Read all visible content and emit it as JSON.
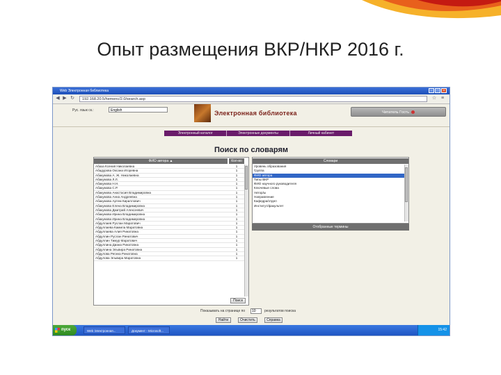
{
  "slide": {
    "title": "Опыт размещения ВКР/НКР 2016 г."
  },
  "browser": {
    "window_title": "Web Электронная библиотека",
    "url": "192.168.20.5/hemenc/2.0/search.asp"
  },
  "site": {
    "lang_label": "Рус.  язык  ск.:",
    "lang_value": "English",
    "library_title": "Электронная библиотека",
    "reader_label": "Читатель Гость",
    "menu": [
      "Электронный каталог",
      "Электронные документы",
      "Личный кабинет"
    ],
    "search_title": "Поиск по словарям"
  },
  "authors": {
    "header_name": "ФИО автора  ▲",
    "header_count": "Кол-во",
    "rows": [
      {
        "name": "Абаза Ксения Николаевна",
        "count": "1"
      },
      {
        "name": "Абадурова Оксана Игоревна",
        "count": "1"
      },
      {
        "name": "Абакумова А. Ж. Николаевна",
        "count": "1"
      },
      {
        "name": "Абакумова Л.Л.",
        "count": "1"
      },
      {
        "name": "Абакумова Н.Н.",
        "count": "1"
      },
      {
        "name": "Абакумова С.Р.",
        "count": "1"
      },
      {
        "name": "Абакумова Анастасия Владимировна",
        "count": "1"
      },
      {
        "name": "Абакумова Анна Андреевна",
        "count": "1"
      },
      {
        "name": "Абакумова Артем Кириллович",
        "count": "1"
      },
      {
        "name": "Абакумова Елена Владимировна",
        "count": "1"
      },
      {
        "name": "Абакумова Дмитрий Алексеевич",
        "count": "1"
      },
      {
        "name": "Абакумова Ирина Владимировна",
        "count": "1"
      },
      {
        "name": "Абакумова Ирина Владимировна",
        "count": "1"
      },
      {
        "name": "Абдуллаев Руслан Маратович",
        "count": "1"
      },
      {
        "name": "Абдуллаева Камила Маратовна",
        "count": "1"
      },
      {
        "name": "Абдуллаева Алия Ринатовна",
        "count": "1"
      },
      {
        "name": "Абдуллин Руслан Ринатович",
        "count": "1"
      },
      {
        "name": "Абдуллин Тимур Маратович",
        "count": "1"
      },
      {
        "name": "Абдуллина Диана Ринатовна",
        "count": "1"
      },
      {
        "name": "Абдуллина Эльвира Ринатовна",
        "count": "1"
      },
      {
        "name": "Абдулова Регина Ринатовна",
        "count": "1"
      },
      {
        "name": "Абдулова Эльвира Маратовна",
        "count": "1"
      }
    ],
    "search_button": "Поиск"
  },
  "dictionaries": {
    "header": "Словари",
    "items": [
      "Уровень образования",
      "Группа",
      "ФИО автора",
      "Типы ВКР",
      "ФИО научного руководителя",
      "Ключевые слова",
      "Автор/ы",
      "Направление",
      "Кафедра/отдел",
      "Институт/факультет"
    ],
    "selected_index": 2,
    "terms_button": "Отобранные термины"
  },
  "results": {
    "show_label": "Показывать на странице по",
    "per_page": "10",
    "results_label": "результатов поиска",
    "find_button": "Найти",
    "clear_button": "Очистить",
    "help_button": "Справка"
  },
  "taskbar": {
    "start_label": "пуск",
    "tasks": [
      "Web Электронная...",
      "Документ - Microsoft..."
    ],
    "clock": "15:42"
  },
  "colors": {
    "menu_bg": "#6a1b6a",
    "selection": "#3166c6",
    "title_red": "#7a2018"
  }
}
